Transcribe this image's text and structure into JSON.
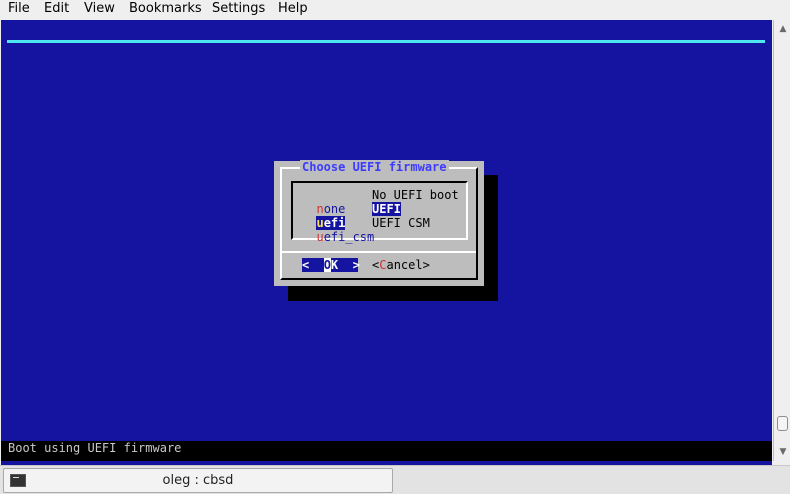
{
  "menubar": {
    "items": [
      "File",
      "Edit",
      "View",
      "Bookmarks",
      "Settings",
      "Help"
    ]
  },
  "dialog": {
    "title": "Choose UEFI firmware",
    "options": [
      {
        "tag_hotkey": "n",
        "tag_rest": "one",
        "description": "No UEFI boot",
        "selected": false
      },
      {
        "tag_hotkey": "u",
        "tag_rest": "efi",
        "description": "UEFI",
        "selected": true
      },
      {
        "tag_hotkey": "u",
        "tag_rest": "efi_csm",
        "description": "UEFI CSM",
        "selected": false
      }
    ],
    "ok_button": {
      "left": "<  ",
      "hotkey": "O",
      "rest": "K  >"
    },
    "cancel_button": {
      "left": "<",
      "hotkey": "C",
      "rest": "ancel>"
    }
  },
  "status_line": "Boot using UEFI firmware",
  "taskbar": {
    "task_label": "oleg : cbsd"
  },
  "colors": {
    "terminal_bg": "#1414a0",
    "dialog_bg": "#bdbdbd",
    "hotkey": "#d03030",
    "title": "#3c3cff",
    "top_line": "#4ee6f0"
  }
}
